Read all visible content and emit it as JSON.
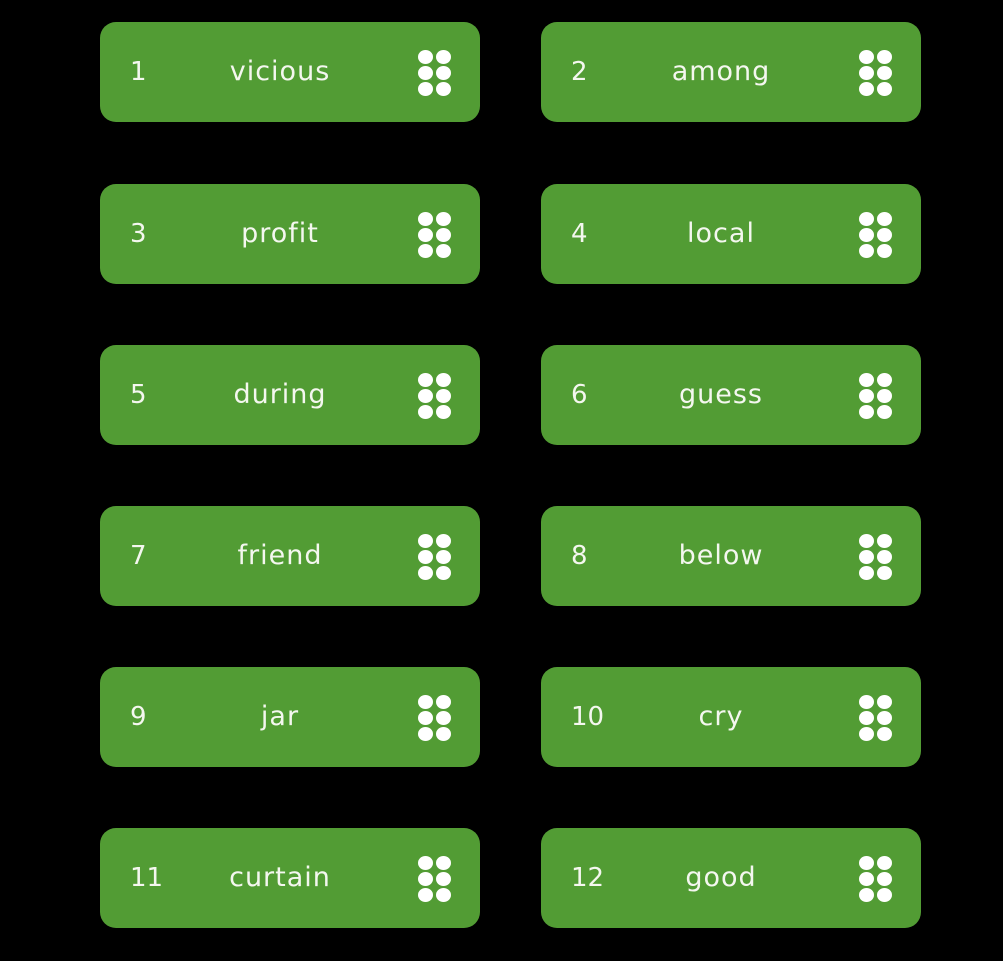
{
  "accent_color": "#529c34",
  "handle_icon": "drag-handle-dots",
  "words": [
    {
      "index": "1",
      "word": "vicious"
    },
    {
      "index": "2",
      "word": "among"
    },
    {
      "index": "3",
      "word": "profit"
    },
    {
      "index": "4",
      "word": "local"
    },
    {
      "index": "5",
      "word": "during"
    },
    {
      "index": "6",
      "word": "guess"
    },
    {
      "index": "7",
      "word": "friend"
    },
    {
      "index": "8",
      "word": "below"
    },
    {
      "index": "9",
      "word": "jar"
    },
    {
      "index": "10",
      "word": "cry"
    },
    {
      "index": "11",
      "word": "curtain"
    },
    {
      "index": "12",
      "word": "good"
    }
  ]
}
